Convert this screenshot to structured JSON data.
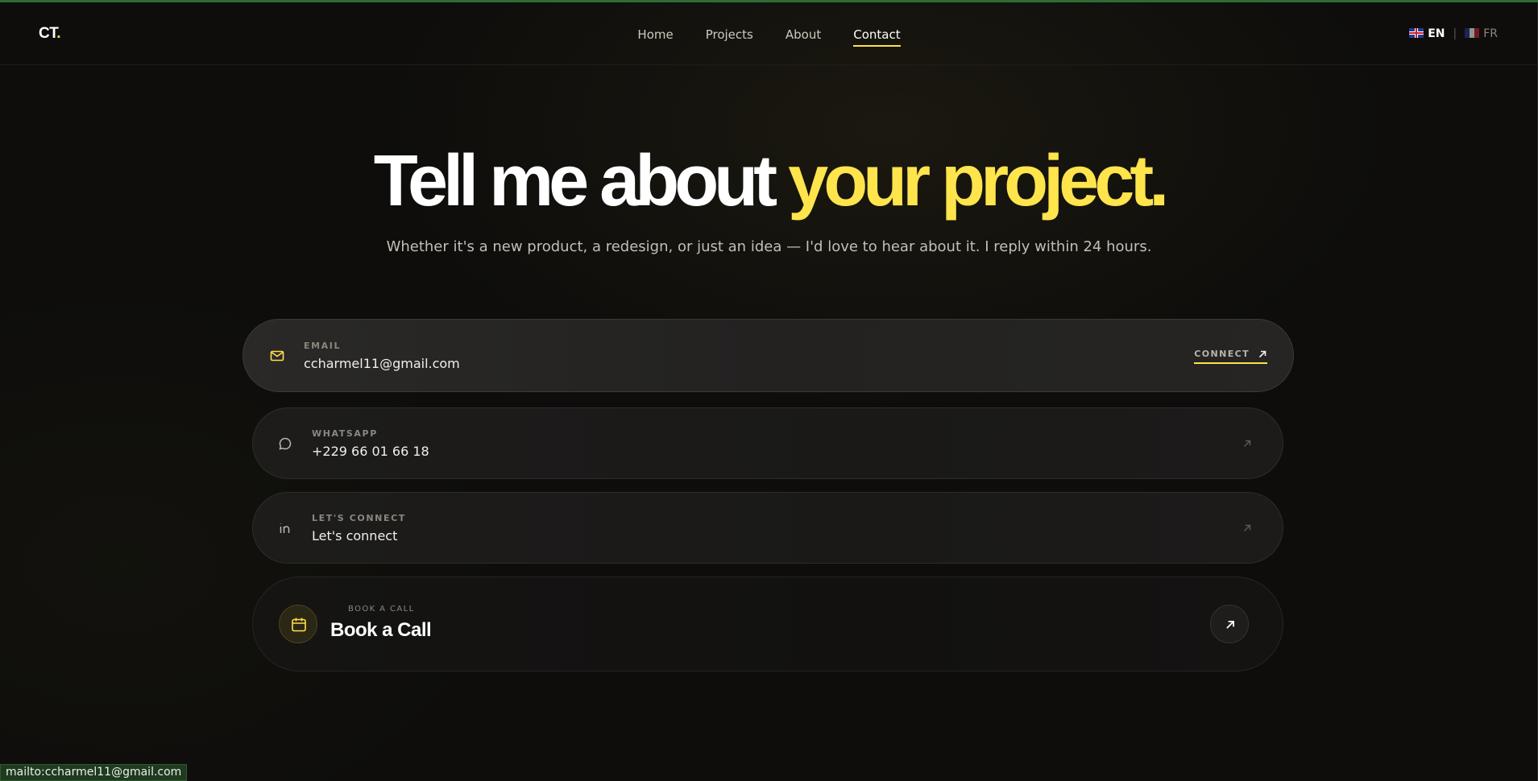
{
  "header": {
    "logo_text": "CT",
    "logo_dot": ".",
    "nav": [
      {
        "label": "Home",
        "active": false
      },
      {
        "label": "Projects",
        "active": false
      },
      {
        "label": "About",
        "active": false
      },
      {
        "label": "Contact",
        "active": true
      }
    ],
    "lang": {
      "current": "EN",
      "other": "FR",
      "separator": "|"
    }
  },
  "hero": {
    "title_main": "Tell me about ",
    "title_accent": "your project.",
    "subtitle": "Whether it's a new product, a redesign, or just an idea — I'd love to hear about it. I reply within 24 hours."
  },
  "contacts": {
    "email": {
      "meta": "EMAIL",
      "value": "ccharmel11@gmail.com",
      "action": "CONNECT",
      "icon": "mail-icon"
    },
    "whatsapp": {
      "meta": "WHATSAPP",
      "value": "+229 66 01 66 18",
      "icon": "chat-bubble-icon"
    },
    "linkedin": {
      "meta": "LET'S CONNECT",
      "value": "Let's connect",
      "icon": "linkedin-icon"
    },
    "call": {
      "meta": "BOOK A CALL",
      "value": "Book a Call",
      "icon": "calendar-icon"
    }
  },
  "statusbar": {
    "text": "mailto:ccharmel11@gmail.com"
  },
  "colors": {
    "accent": "#ffe44c",
    "background": "#0e0d0c"
  }
}
